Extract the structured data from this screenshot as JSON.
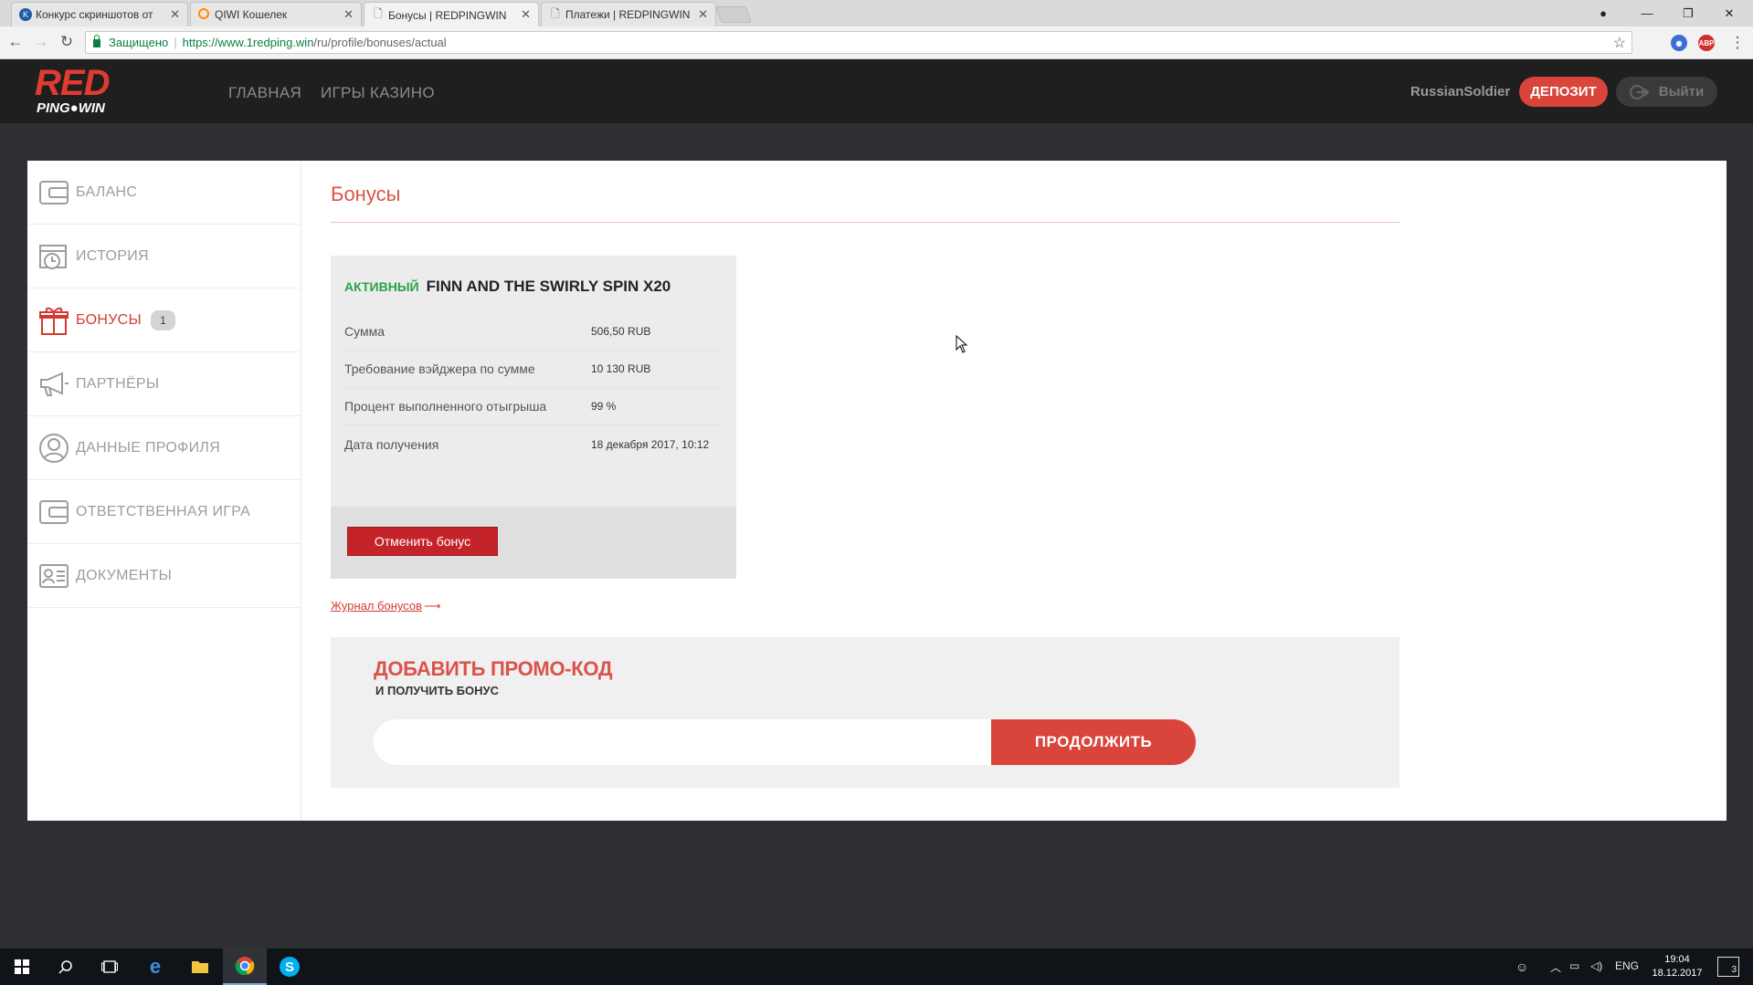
{
  "browser": {
    "tabs": [
      {
        "label": "Конкурс скриншотов от",
        "favicon": "K",
        "favicon_color": "#1e5ca8"
      },
      {
        "label": "QIWI Кошелек",
        "favicon": "Q",
        "favicon_color": "#ff8c00"
      },
      {
        "label": "Бонусы | REDPINGWIN",
        "favicon": "page",
        "favicon_color": "#888888"
      },
      {
        "label": "Платежи | REDPINGWIN",
        "favicon": "page",
        "favicon_color": "#888888"
      }
    ],
    "active_tab_index": 2,
    "secure_label": "Защищено",
    "url_host": "https://www.1redping.win",
    "url_path": "/ru/profile/bonuses/actual",
    "ext_abp": "ABP"
  },
  "header": {
    "logo_top": "RED",
    "logo_bottom": "PING●WIN",
    "nav": [
      "ГЛАВНАЯ",
      "ИГРЫ КАЗИНО"
    ],
    "username": "RussianSoldier",
    "deposit_label": "ДЕПОЗИТ",
    "logout_label": "Выйти"
  },
  "sidebar": {
    "items": [
      {
        "label": "БАЛАНС",
        "icon": "wallet-icon"
      },
      {
        "label": "ИСТОРИЯ",
        "icon": "calendar-clock-icon"
      },
      {
        "label": "БОНУСЫ",
        "icon": "gift-icon",
        "badge": "1",
        "active": true
      },
      {
        "label": "ПАРТНЁРЫ",
        "icon": "megaphone-icon"
      },
      {
        "label": "ДАННЫЕ ПРОФИЛЯ",
        "icon": "user-icon"
      },
      {
        "label": "ОТВЕТСТВЕННАЯ ИГРА",
        "icon": "wallet-icon"
      },
      {
        "label": "ДОКУМЕНТЫ",
        "icon": "id-card-icon"
      }
    ]
  },
  "main": {
    "title": "Бонусы",
    "bonus": {
      "status": "АКТИВНЫЙ",
      "name": "FINN AND THE SWIRLY SPIN X20",
      "rows": [
        {
          "key": "Сумма",
          "value": "506,50 RUB"
        },
        {
          "key": "Требование вэйджера по сумме",
          "value": "10 130 RUB"
        },
        {
          "key": "Процент выполненного отыгрыша",
          "value": "99 %"
        },
        {
          "key": "Дата получения",
          "value": "18 декабря 2017, 10:12"
        }
      ],
      "cancel_label": "Отменить бонус"
    },
    "journal_link": "Журнал бонусов",
    "promo": {
      "title": "ДОБАВИТЬ ПРОМО-КОД",
      "subtitle": "И ПОЛУЧИТЬ БОНУС",
      "input_value": "",
      "button_label": "ПРОДОЛЖИТЬ"
    }
  },
  "taskbar": {
    "lang": "ENG",
    "time": "19:04",
    "date": "18.12.2017",
    "notifications": "3"
  },
  "colors": {
    "accent": "#d9443b",
    "active_green": "#2aa14a",
    "header_bg": "#1f1f1f"
  }
}
